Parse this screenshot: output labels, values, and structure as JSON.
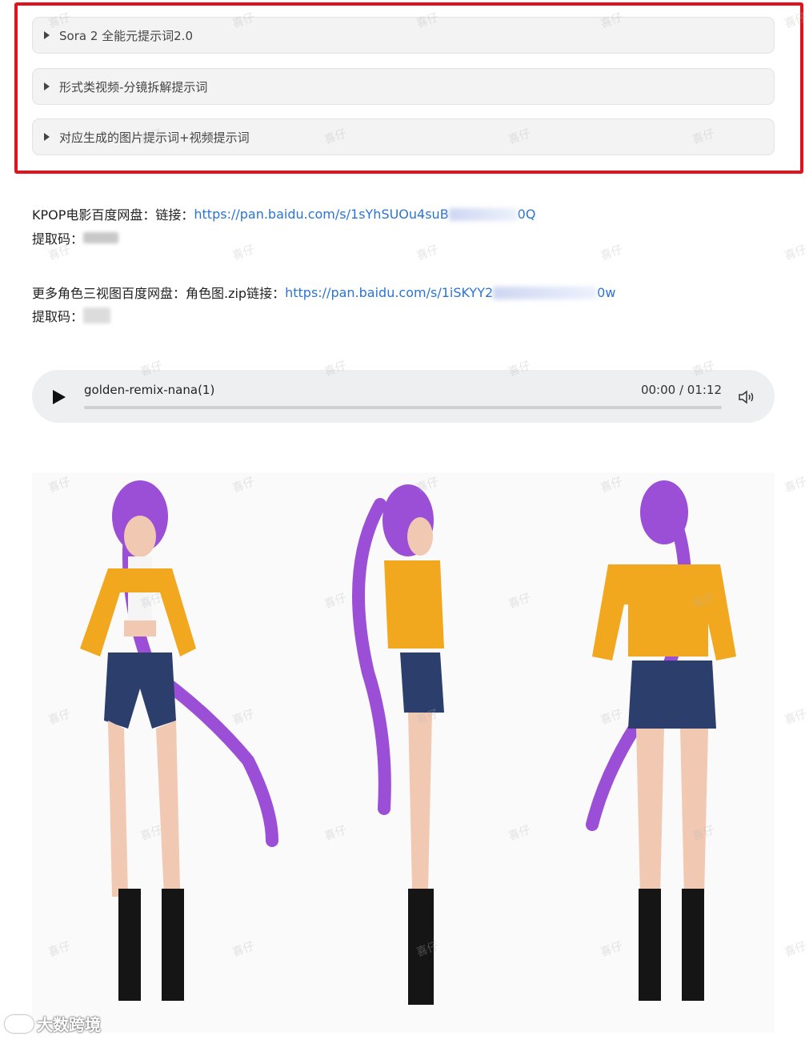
{
  "sections": [
    {
      "label": "Sora 2 全能元提示词2.0"
    },
    {
      "label": "形式类视频-分镜拆解提示词"
    },
    {
      "label": "对应生成的图片提示词+视频提示词"
    }
  ],
  "kpop": {
    "prefix": "KPOP电影百度网盘：链接：",
    "link_start": "https://pan.baidu.com/s/1sYhSUOu4suB",
    "link_end": "0Q",
    "code_label": "提取码："
  },
  "more": {
    "prefix": "更多角色三视图百度网盘：角色图.zip链接：",
    "link_start": "https://pan.baidu.com/s/1iSKYY2",
    "link_end": "0w",
    "code_label": "提取码："
  },
  "audio": {
    "track": "golden-remix-nana(1)",
    "time": "00:00 / 01:12",
    "progress": 0,
    "icons": {
      "play": "play-icon",
      "volume": "volume-icon"
    }
  },
  "watermark": {
    "text": "喜仔"
  },
  "bottom_logo": {
    "text": "大数跨境"
  },
  "colors": {
    "highlight": "#e0121c",
    "link": "#2a74d4",
    "hair": "#9b4fd6",
    "jacket": "#f2a81e"
  }
}
